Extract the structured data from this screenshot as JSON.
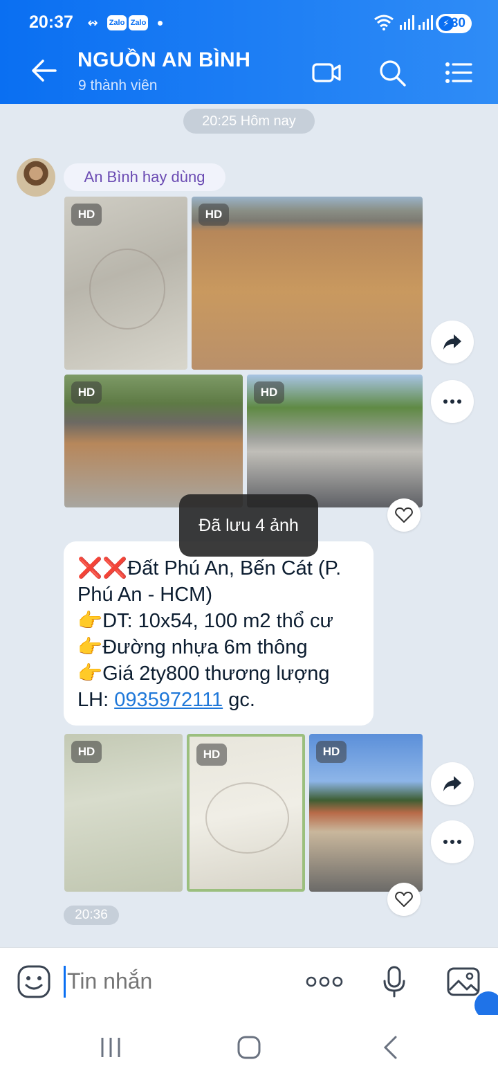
{
  "status_bar": {
    "time": "20:37",
    "zalo_icon_1": "Zalo",
    "zalo_icon_2": "Zalo",
    "battery": "30"
  },
  "header": {
    "title": "NGUỒN AN BÌNH",
    "subtitle": "9 thành viên"
  },
  "chat": {
    "date_separator": "20:25 Hôm nay",
    "sender_name": "An Bình hay dùng",
    "photo_badge": "HD",
    "toast": "Đã lưu 4 ảnh",
    "message": {
      "line1_marks": "❌❌",
      "line1": "Đất Phú An, Bến Cát (P.",
      "line2": "Phú An -  HCM)",
      "line3_mark": "👉",
      "line3": "DT: 10x54, 100 m2 thổ cư",
      "line4_mark": "👉",
      "line4": "Đường nhựa 6m thông",
      "line5_mark": "👉",
      "line5": "Giá 2ty800 thương lượng",
      "line6_prefix": "LH: ",
      "line6_phone": "0935972111",
      "line6_suffix": " gc."
    },
    "last_time": "20:36"
  },
  "composer": {
    "placeholder": "Tin nhắn"
  },
  "icons": {
    "back": "arrow-left-icon",
    "video": "video-camera-icon",
    "search": "search-icon",
    "menu": "menu-list-icon",
    "share": "share-arrow-icon",
    "more": "more-dots-icon",
    "like": "heart-icon",
    "emoji": "emoji-icon",
    "mic": "microphone-icon",
    "image": "image-icon"
  },
  "colors": {
    "header_blue": "#0a6ff2",
    "chat_background": "#e2e9f1",
    "link_blue": "#1f78d9",
    "sender_purple": "#6b4bb3"
  }
}
